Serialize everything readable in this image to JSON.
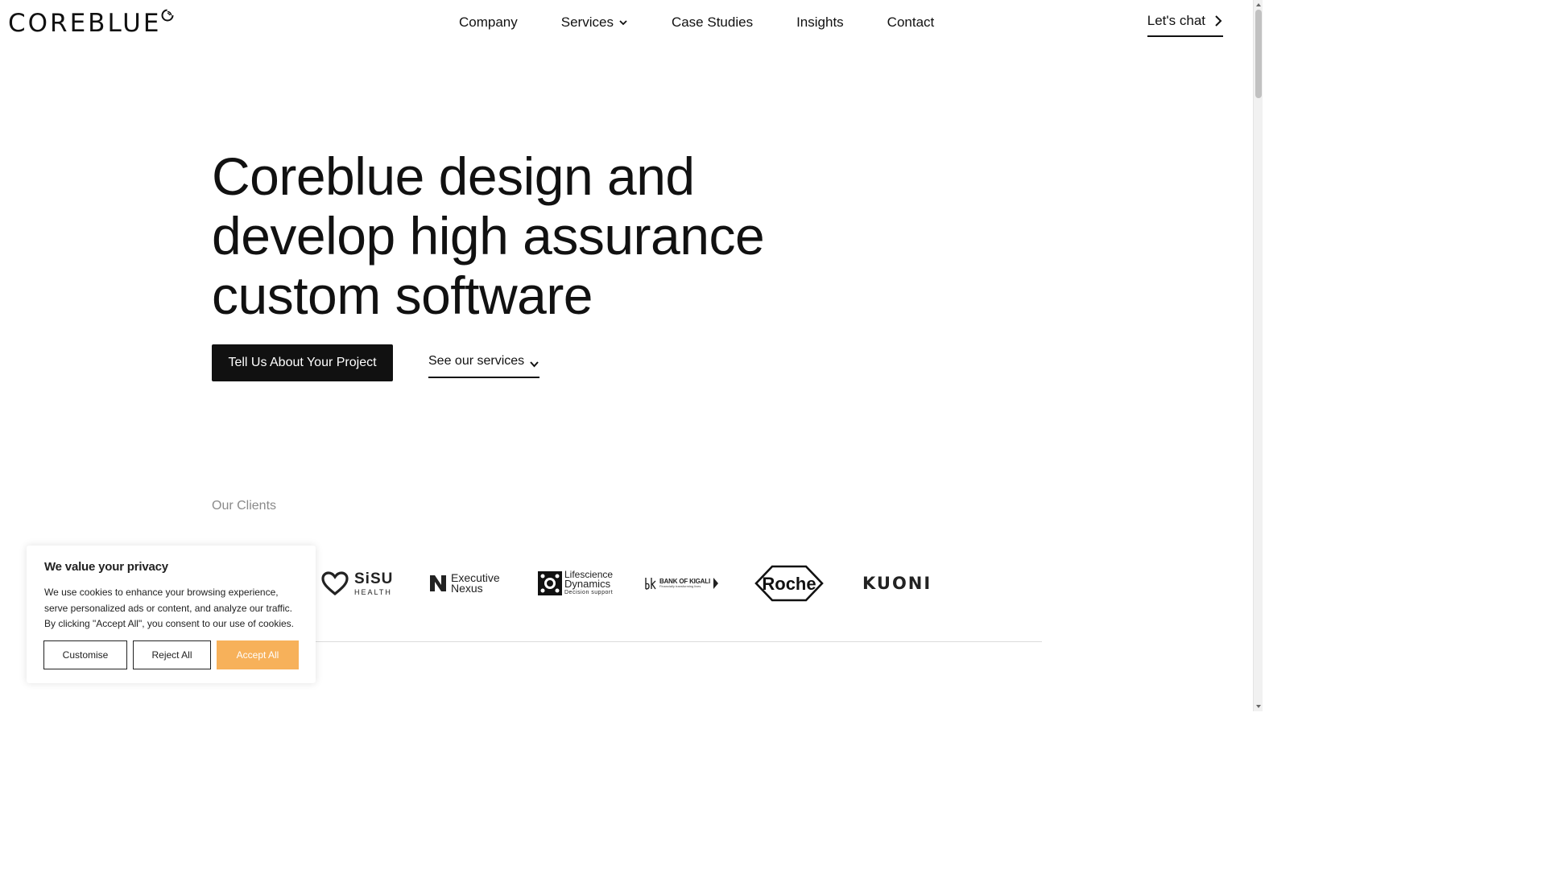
{
  "brand": {
    "logo_text": "COREBLUE",
    "logo_icon": "coreblue-swirl-icon"
  },
  "nav": {
    "items": [
      {
        "label": "Company",
        "has_dropdown": false
      },
      {
        "label": "Services",
        "has_dropdown": true
      },
      {
        "label": "Case Studies",
        "has_dropdown": false
      },
      {
        "label": "Insights",
        "has_dropdown": false
      },
      {
        "label": "Contact",
        "has_dropdown": false
      }
    ],
    "cta_label": "Let's chat"
  },
  "hero": {
    "title": "Coreblue design and develop high assurance custom software",
    "primary_cta": "Tell Us About Your Project",
    "secondary_cta": "See our services"
  },
  "clients": {
    "label": "Our Clients",
    "logos": {
      "sisu_main": "SiSU",
      "sisu_sub": "HEALTH",
      "exec_line1": "Executive",
      "exec_line2": "Nexus",
      "life_line1": "Lifescience",
      "life_line2": "Dynamics",
      "life_line3": "Decision support",
      "bok_line1": "BANK OF KIGALI",
      "bok_line2": "Financially transforming lives",
      "roche": "Roche",
      "kuoni": "KUONI"
    }
  },
  "cookie_banner": {
    "title": "We value your privacy",
    "body": "We use cookies to enhance your browsing experience, serve personalized ads or content, and analyze our traffic. By clicking \"Accept All\", you consent to our use of cookies.",
    "customise_label": "Customise",
    "reject_label": "Reject All",
    "accept_label": "Accept All",
    "accept_color": "#f7b15a"
  }
}
